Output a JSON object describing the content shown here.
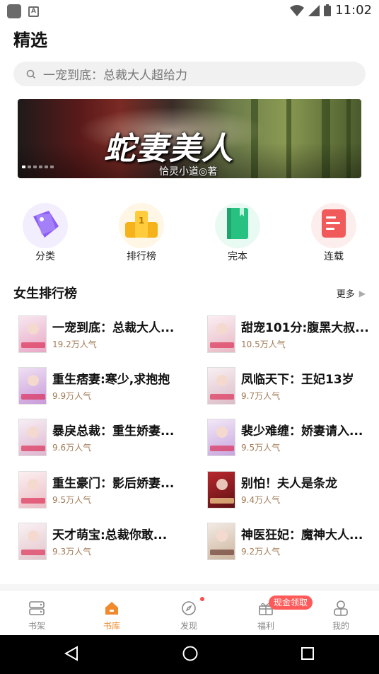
{
  "status": {
    "time": "11:02"
  },
  "page": {
    "title": "精选"
  },
  "search": {
    "placeholder": "一宠到底：总裁大人超给力"
  },
  "banner": {
    "title": "蛇妻美人",
    "author": "恰灵小道◎著"
  },
  "categories": [
    {
      "label": "分类",
      "icon": "tag-icon",
      "color": "#8b5cf6"
    },
    {
      "label": "排行榜",
      "icon": "trophy-icon",
      "color": "#f5b21b"
    },
    {
      "label": "完本",
      "icon": "book-icon",
      "color": "#27c281"
    },
    {
      "label": "连载",
      "icon": "scroll-icon",
      "color": "#f15a5a"
    }
  ],
  "section": {
    "title": "女生排行榜",
    "more": "更多"
  },
  "books": [
    {
      "title": "一宠到底：总裁大人...",
      "pop": "19.2万人气",
      "color": "#f2c6d8"
    },
    {
      "title": "甜宠101分:腹黑大叔...",
      "pop": "10.5万人气",
      "color": "#f3d5dc"
    },
    {
      "title": "重生痞妻:寒少,求抱抱",
      "pop": "9.9万人气",
      "color": "#e8c9e6"
    },
    {
      "title": "凤临天下：王妃13岁",
      "pop": "9.7万人气",
      "color": "#f1e2e8"
    },
    {
      "title": "暴戾总裁：重生娇妻...",
      "pop": "9.6万人气",
      "color": "#f0dce8"
    },
    {
      "title": "裴少难缠：娇妻请入...",
      "pop": "9.5万人气",
      "color": "#e9d3ef"
    },
    {
      "title": "重生豪门：影后娇妻...",
      "pop": "9.5万人气",
      "color": "#f4d8dc"
    },
    {
      "title": "别怕！夫人是条龙",
      "pop": "9.4万人气",
      "color": "#8a1f24"
    },
    {
      "title": "天才萌宝:总裁你敢...",
      "pop": "9.3万人气",
      "color": "#f0e1e4"
    },
    {
      "title": "神医狂妃：魔神大人...",
      "pop": "9.2万人气",
      "color": "#e6d6cc"
    }
  ],
  "tabs": [
    {
      "label": "书架",
      "icon": "bookshelf-icon"
    },
    {
      "label": "书库",
      "icon": "home-icon"
    },
    {
      "label": "发现",
      "icon": "compass-icon"
    },
    {
      "label": "福利",
      "icon": "gift-icon"
    },
    {
      "label": "我的",
      "icon": "profile-icon"
    }
  ],
  "welfare_badge": "现金领取",
  "colors": {
    "accent": "#f08a2c",
    "popularity": "#a07a55",
    "badge": "#ff5a5a"
  }
}
